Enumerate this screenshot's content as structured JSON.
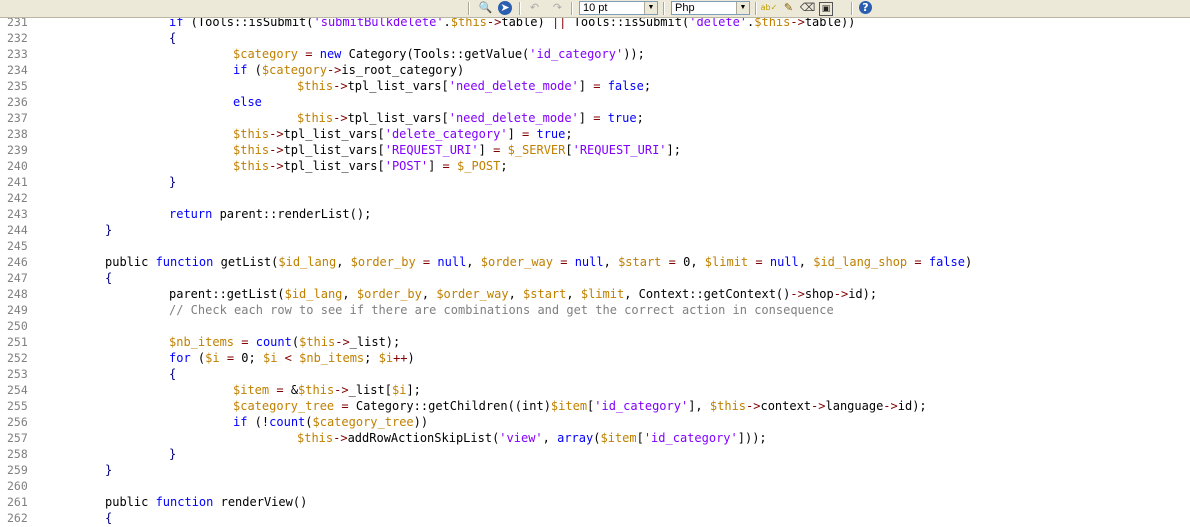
{
  "toolbar": {
    "font_size": "10 pt",
    "language": "Php",
    "icons": [
      {
        "name": "binoculars-icon",
        "glyph": "🔍"
      },
      {
        "name": "goto-icon",
        "glyph": "➤"
      },
      {
        "name": "undo-icon",
        "glyph": "↶"
      },
      {
        "name": "redo-icon",
        "glyph": "↷"
      },
      {
        "name": "spellcheck-icon",
        "glyph": "ab✓"
      },
      {
        "name": "brush-icon",
        "glyph": "✎"
      },
      {
        "name": "eraser-icon",
        "glyph": "⌫"
      },
      {
        "name": "save-icon",
        "glyph": "▣"
      },
      {
        "name": "help-icon",
        "glyph": "?"
      }
    ]
  },
  "lines": [
    {
      "n": "231",
      "indent": 2,
      "tokens": [
        [
          "kw",
          "if"
        ],
        [
          "pl",
          " ("
        ],
        [
          "pl",
          "Tools::isSubmit("
        ],
        [
          "str",
          "'submitBulkdelete'"
        ],
        [
          "pl",
          "."
        ],
        [
          "var",
          "$this"
        ],
        [
          "op",
          "->"
        ],
        [
          "pl",
          "table) "
        ],
        [
          "op",
          "||"
        ],
        [
          "pl",
          " Tools::isSubmit("
        ],
        [
          "str",
          "'delete'"
        ],
        [
          "pl",
          "."
        ],
        [
          "var",
          "$this"
        ],
        [
          "op",
          "->"
        ],
        [
          "pl",
          "table))"
        ]
      ]
    },
    {
      "n": "232",
      "indent": 2,
      "tokens": [
        [
          "br",
          "{"
        ]
      ]
    },
    {
      "n": "233",
      "indent": 3,
      "tokens": [
        [
          "var",
          "$category"
        ],
        [
          "pl",
          " "
        ],
        [
          "op",
          "="
        ],
        [
          "pl",
          " "
        ],
        [
          "kw",
          "new"
        ],
        [
          "pl",
          " Category(Tools::getValue("
        ],
        [
          "str",
          "'id_category'"
        ],
        [
          "pl",
          "));"
        ]
      ]
    },
    {
      "n": "234",
      "indent": 3,
      "tokens": [
        [
          "kw",
          "if"
        ],
        [
          "pl",
          " ("
        ],
        [
          "var",
          "$category"
        ],
        [
          "op",
          "->"
        ],
        [
          "pl",
          "is_root_category)"
        ]
      ]
    },
    {
      "n": "235",
      "indent": 4,
      "tokens": [
        [
          "var",
          "$this"
        ],
        [
          "op",
          "->"
        ],
        [
          "pl",
          "tpl_list_vars["
        ],
        [
          "str",
          "'need_delete_mode'"
        ],
        [
          "pl",
          "] "
        ],
        [
          "op",
          "="
        ],
        [
          "pl",
          " "
        ],
        [
          "kw",
          "false"
        ],
        [
          "pl",
          ";"
        ]
      ]
    },
    {
      "n": "236",
      "indent": 3,
      "tokens": [
        [
          "kw",
          "else"
        ]
      ]
    },
    {
      "n": "237",
      "indent": 4,
      "tokens": [
        [
          "var",
          "$this"
        ],
        [
          "op",
          "->"
        ],
        [
          "pl",
          "tpl_list_vars["
        ],
        [
          "str",
          "'need_delete_mode'"
        ],
        [
          "pl",
          "] "
        ],
        [
          "op",
          "="
        ],
        [
          "pl",
          " "
        ],
        [
          "kw",
          "true"
        ],
        [
          "pl",
          ";"
        ]
      ]
    },
    {
      "n": "238",
      "indent": 3,
      "tokens": [
        [
          "var",
          "$this"
        ],
        [
          "op",
          "->"
        ],
        [
          "pl",
          "tpl_list_vars["
        ],
        [
          "str",
          "'delete_category'"
        ],
        [
          "pl",
          "] "
        ],
        [
          "op",
          "="
        ],
        [
          "pl",
          " "
        ],
        [
          "kw",
          "true"
        ],
        [
          "pl",
          ";"
        ]
      ]
    },
    {
      "n": "239",
      "indent": 3,
      "tokens": [
        [
          "var",
          "$this"
        ],
        [
          "op",
          "->"
        ],
        [
          "pl",
          "tpl_list_vars["
        ],
        [
          "str",
          "'REQUEST_URI'"
        ],
        [
          "pl",
          "] "
        ],
        [
          "op",
          "="
        ],
        [
          "pl",
          " "
        ],
        [
          "var",
          "$_SERVER"
        ],
        [
          "pl",
          "["
        ],
        [
          "str",
          "'REQUEST_URI'"
        ],
        [
          "pl",
          "];"
        ]
      ]
    },
    {
      "n": "240",
      "indent": 3,
      "tokens": [
        [
          "var",
          "$this"
        ],
        [
          "op",
          "->"
        ],
        [
          "pl",
          "tpl_list_vars["
        ],
        [
          "str",
          "'POST'"
        ],
        [
          "pl",
          "] "
        ],
        [
          "op",
          "="
        ],
        [
          "pl",
          " "
        ],
        [
          "var",
          "$_POST"
        ],
        [
          "pl",
          ";"
        ]
      ]
    },
    {
      "n": "241",
      "indent": 2,
      "tokens": [
        [
          "br",
          "}"
        ]
      ]
    },
    {
      "n": "242",
      "indent": 0,
      "tokens": []
    },
    {
      "n": "243",
      "indent": 2,
      "tokens": [
        [
          "kw",
          "return"
        ],
        [
          "pl",
          " parent::renderList();"
        ]
      ]
    },
    {
      "n": "244",
      "indent": 1,
      "tokens": [
        [
          "br",
          "}"
        ]
      ]
    },
    {
      "n": "245",
      "indent": 0,
      "tokens": []
    },
    {
      "n": "246",
      "indent": 1,
      "tokens": [
        [
          "pl",
          "public "
        ],
        [
          "kw",
          "function"
        ],
        [
          "pl",
          " getList("
        ],
        [
          "var",
          "$id_lang"
        ],
        [
          "pl",
          ", "
        ],
        [
          "var",
          "$order_by"
        ],
        [
          "pl",
          " "
        ],
        [
          "op",
          "="
        ],
        [
          "pl",
          " "
        ],
        [
          "kw",
          "null"
        ],
        [
          "pl",
          ", "
        ],
        [
          "var",
          "$order_way"
        ],
        [
          "pl",
          " "
        ],
        [
          "op",
          "="
        ],
        [
          "pl",
          " "
        ],
        [
          "kw",
          "null"
        ],
        [
          "pl",
          ", "
        ],
        [
          "var",
          "$start"
        ],
        [
          "pl",
          " "
        ],
        [
          "op",
          "="
        ],
        [
          "pl",
          " 0, "
        ],
        [
          "var",
          "$limit"
        ],
        [
          "pl",
          " "
        ],
        [
          "op",
          "="
        ],
        [
          "pl",
          " "
        ],
        [
          "kw",
          "null"
        ],
        [
          "pl",
          ", "
        ],
        [
          "var",
          "$id_lang_shop"
        ],
        [
          "pl",
          " "
        ],
        [
          "op",
          "="
        ],
        [
          "pl",
          " "
        ],
        [
          "kw",
          "false"
        ],
        [
          "pl",
          ")"
        ]
      ]
    },
    {
      "n": "247",
      "indent": 1,
      "tokens": [
        [
          "br",
          "{"
        ]
      ]
    },
    {
      "n": "248",
      "indent": 2,
      "tokens": [
        [
          "pl",
          "parent::getList("
        ],
        [
          "var",
          "$id_lang"
        ],
        [
          "pl",
          ", "
        ],
        [
          "var",
          "$order_by"
        ],
        [
          "pl",
          ", "
        ],
        [
          "var",
          "$order_way"
        ],
        [
          "pl",
          ", "
        ],
        [
          "var",
          "$start"
        ],
        [
          "pl",
          ", "
        ],
        [
          "var",
          "$limit"
        ],
        [
          "pl",
          ", Context::getContext()"
        ],
        [
          "op",
          "->"
        ],
        [
          "pl",
          "shop"
        ],
        [
          "op",
          "->"
        ],
        [
          "pl",
          "id);"
        ]
      ]
    },
    {
      "n": "249",
      "indent": 2,
      "tokens": [
        [
          "cmt",
          "// Check each row to see if there are combinations and get the correct action in consequence"
        ]
      ]
    },
    {
      "n": "250",
      "indent": 0,
      "tokens": []
    },
    {
      "n": "251",
      "indent": 2,
      "tokens": [
        [
          "var",
          "$nb_items"
        ],
        [
          "pl",
          " "
        ],
        [
          "op",
          "="
        ],
        [
          "pl",
          " "
        ],
        [
          "kw",
          "count"
        ],
        [
          "pl",
          "("
        ],
        [
          "var",
          "$this"
        ],
        [
          "op",
          "->"
        ],
        [
          "pl",
          "_list);"
        ]
      ]
    },
    {
      "n": "252",
      "indent": 2,
      "tokens": [
        [
          "kw",
          "for"
        ],
        [
          "pl",
          " ("
        ],
        [
          "var",
          "$i"
        ],
        [
          "pl",
          " "
        ],
        [
          "op",
          "="
        ],
        [
          "pl",
          " 0; "
        ],
        [
          "var",
          "$i"
        ],
        [
          "pl",
          " "
        ],
        [
          "op",
          "<"
        ],
        [
          "pl",
          " "
        ],
        [
          "var",
          "$nb_items"
        ],
        [
          "pl",
          "; "
        ],
        [
          "var",
          "$i"
        ],
        [
          "op",
          "++"
        ],
        [
          "pl",
          ")"
        ]
      ]
    },
    {
      "n": "253",
      "indent": 2,
      "tokens": [
        [
          "br",
          "{"
        ]
      ]
    },
    {
      "n": "254",
      "indent": 3,
      "tokens": [
        [
          "var",
          "$item"
        ],
        [
          "pl",
          " "
        ],
        [
          "op",
          "="
        ],
        [
          "pl",
          " &"
        ],
        [
          "var",
          "$this"
        ],
        [
          "op",
          "->"
        ],
        [
          "pl",
          "_list["
        ],
        [
          "var",
          "$i"
        ],
        [
          "pl",
          "];"
        ]
      ]
    },
    {
      "n": "255",
      "indent": 3,
      "tokens": [
        [
          "var",
          "$category_tree"
        ],
        [
          "pl",
          " "
        ],
        [
          "op",
          "="
        ],
        [
          "pl",
          " Category::getChildren((int)"
        ],
        [
          "var",
          "$item"
        ],
        [
          "pl",
          "["
        ],
        [
          "str",
          "'id_category'"
        ],
        [
          "pl",
          "], "
        ],
        [
          "var",
          "$this"
        ],
        [
          "op",
          "->"
        ],
        [
          "pl",
          "context"
        ],
        [
          "op",
          "->"
        ],
        [
          "pl",
          "language"
        ],
        [
          "op",
          "->"
        ],
        [
          "pl",
          "id);"
        ]
      ]
    },
    {
      "n": "256",
      "indent": 3,
      "tokens": [
        [
          "kw",
          "if"
        ],
        [
          "pl",
          " (!"
        ],
        [
          "kw",
          "count"
        ],
        [
          "pl",
          "("
        ],
        [
          "var",
          "$category_tree"
        ],
        [
          "pl",
          "))"
        ]
      ]
    },
    {
      "n": "257",
      "indent": 4,
      "tokens": [
        [
          "var",
          "$this"
        ],
        [
          "op",
          "->"
        ],
        [
          "pl",
          "addRowActionSkipList("
        ],
        [
          "str",
          "'view'"
        ],
        [
          "pl",
          ", "
        ],
        [
          "kw",
          "array"
        ],
        [
          "pl",
          "("
        ],
        [
          "var",
          "$item"
        ],
        [
          "pl",
          "["
        ],
        [
          "str",
          "'id_category'"
        ],
        [
          "pl",
          "]));"
        ]
      ]
    },
    {
      "n": "258",
      "indent": 2,
      "tokens": [
        [
          "br",
          "}"
        ]
      ]
    },
    {
      "n": "259",
      "indent": 1,
      "tokens": [
        [
          "br",
          "}"
        ]
      ]
    },
    {
      "n": "260",
      "indent": 0,
      "tokens": []
    },
    {
      "n": "261",
      "indent": 1,
      "tokens": [
        [
          "pl",
          "public "
        ],
        [
          "kw",
          "function"
        ],
        [
          "pl",
          " renderView()"
        ]
      ]
    },
    {
      "n": "262",
      "indent": 1,
      "tokens": [
        [
          "br",
          "{"
        ]
      ]
    }
  ]
}
